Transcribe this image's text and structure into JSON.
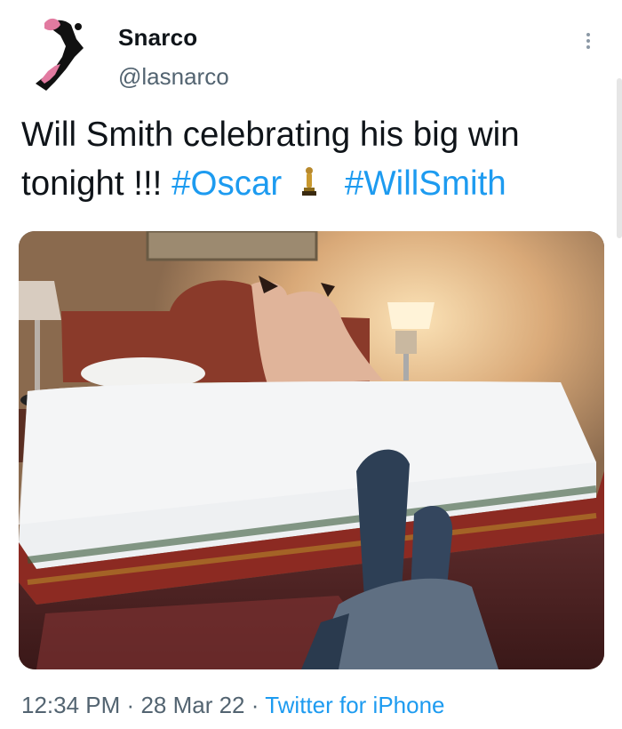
{
  "tweet": {
    "display_name": "Snarco",
    "handle": "@lasnarco",
    "text_1": "Will Smith celebrating his big win tonight !!!",
    "hashtag_1": "#Oscar",
    "hashtag_2": "#WillSmith",
    "time": "12:34 PM",
    "date": "28 Mar 22",
    "source": "Twitter for iPhone",
    "separator": "·"
  },
  "icons": {
    "avatar": "avatar-illustration",
    "trophy": "oscar-trophy-emoji",
    "more": "more-options-icon"
  },
  "colors": {
    "link": "#1d9bf0",
    "text": "#0f1419",
    "secondary": "#536471"
  }
}
